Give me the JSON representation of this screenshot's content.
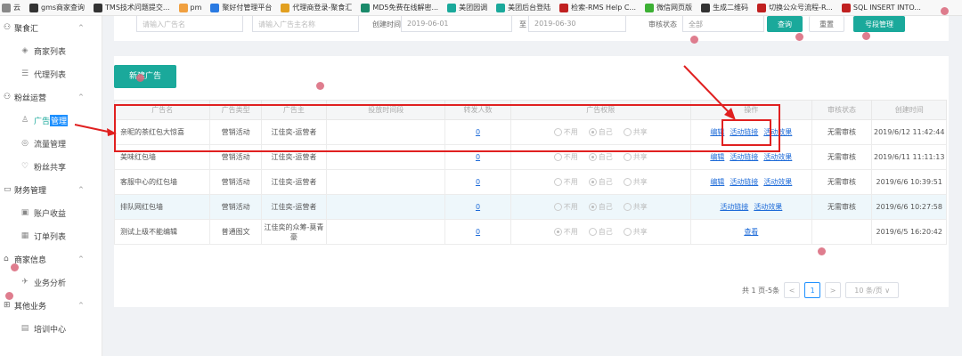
{
  "bookmarks": [
    {
      "label": "云",
      "color": "#888"
    },
    {
      "label": "gms商家查询",
      "color": "#333"
    },
    {
      "label": "TMS技术问题提交...",
      "color": "#333"
    },
    {
      "label": "pm",
      "color": "#f0a040"
    },
    {
      "label": "聚好付管理平台",
      "color": "#2a7ae2"
    },
    {
      "label": "代理商登录-聚食汇",
      "color": "#e2a020"
    },
    {
      "label": "MD5免费在线解密...",
      "color": "#1a8a6a"
    },
    {
      "label": "美团园调",
      "color": "#1aa99b"
    },
    {
      "label": "美团后台登陆",
      "color": "#1aa99b"
    },
    {
      "label": "检索-RMS Help C...",
      "color": "#c02020"
    },
    {
      "label": "微信网页版",
      "color": "#3cb034"
    },
    {
      "label": "生成二维码",
      "color": "#333"
    },
    {
      "label": "切换公众号流程-R...",
      "color": "#c02020"
    },
    {
      "label": "SQL INSERT INTO...",
      "color": "#c02020"
    }
  ],
  "sidebar": {
    "groups": [
      {
        "label": "聚食汇",
        "items": [
          {
            "label": "商家列表"
          },
          {
            "label": "代理列表"
          }
        ]
      },
      {
        "label": "粉丝运营",
        "items": [
          {
            "label_a": "广告",
            "label_b": "管理"
          },
          {
            "label": "流量管理"
          },
          {
            "label": "粉丝共享"
          }
        ]
      },
      {
        "label": "财务管理",
        "items": [
          {
            "label": "账户收益"
          },
          {
            "label": "订单列表"
          }
        ]
      },
      {
        "label": "商家信息",
        "items": [
          {
            "label": "业务分析"
          }
        ]
      },
      {
        "label": "其他业务",
        "items": [
          {
            "label": "培训中心"
          }
        ]
      }
    ]
  },
  "filters": {
    "input1_placeholder": "请输入广告名",
    "input2_placeholder": "请输入广告主名称",
    "date_label": "创建时间",
    "date_from": "2019-06-01",
    "date_sep": "至",
    "date_to": "2019-06-30",
    "status_label": "审核状态",
    "status_value": "全部",
    "query_btn": "查询",
    "reset_btn": "重置",
    "manage_btn": "号段管理"
  },
  "add_button": "新建广告",
  "table": {
    "headers": [
      "广告名",
      "广告类型",
      "广告主",
      "投放时间段",
      "转发人数",
      "广告权限",
      "操作",
      "审核状态",
      "创建时间"
    ],
    "radio_labels": [
      "不用",
      "自己",
      "共享"
    ],
    "rows": [
      {
        "name": "亲昵的茶红包大惊喜",
        "type": "营销活动",
        "owner": "江佳奕-运营者",
        "period": "",
        "count": "0",
        "perm": 1,
        "ops": [
          "编辑",
          "活动链接",
          "活动效果"
        ],
        "status": "无需审核",
        "created": "2019/6/12 11:42:44"
      },
      {
        "name": "美味红包墙",
        "type": "营销活动",
        "owner": "江佳奕-运营者",
        "period": "",
        "count": "0",
        "perm": 1,
        "ops": [
          "编辑",
          "活动链接",
          "活动效果"
        ],
        "status": "无需审核",
        "created": "2019/6/11 11:11:13"
      },
      {
        "name": "客服中心的红包墙",
        "type": "营销活动",
        "owner": "江佳奕-运营者",
        "period": "",
        "count": "0",
        "perm": 1,
        "ops": [
          "编辑",
          "活动链接",
          "活动效果"
        ],
        "status": "无需审核",
        "created": "2019/6/6 10:39:51"
      },
      {
        "name": "排队网红包墙",
        "type": "营销活动",
        "owner": "江佳奕-运营者",
        "period": "",
        "count": "0",
        "perm": 1,
        "ops": [
          "活动链接",
          "活动效果"
        ],
        "status": "无需审核",
        "created": "2019/6/6 10:27:58"
      },
      {
        "name": "测试上级不能编辑",
        "type": "普通图文",
        "owner": "江佳奕的众筹-莫青豪",
        "period": "",
        "count": "0",
        "perm": 0,
        "ops": [
          "查看"
        ],
        "status": "",
        "created": "2019/6/5 16:20:42"
      }
    ]
  },
  "pager": {
    "total": "共 1 页-5条",
    "prev": "<",
    "current": "1",
    "next": ">",
    "page_size": "10 条/页"
  }
}
